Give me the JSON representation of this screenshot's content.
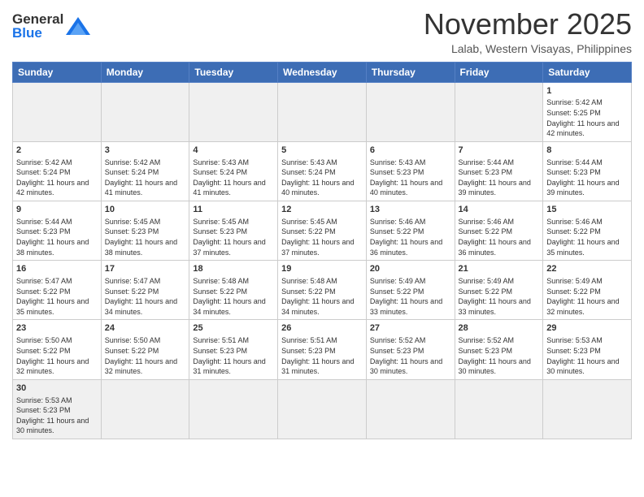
{
  "header": {
    "logo_text_general": "General",
    "logo_text_blue": "Blue",
    "month_title": "November 2025",
    "location": "Lalab, Western Visayas, Philippines"
  },
  "days_of_week": [
    "Sunday",
    "Monday",
    "Tuesday",
    "Wednesday",
    "Thursday",
    "Friday",
    "Saturday"
  ],
  "weeks": [
    [
      {
        "day": "",
        "empty": true
      },
      {
        "day": "",
        "empty": true
      },
      {
        "day": "",
        "empty": true
      },
      {
        "day": "",
        "empty": true
      },
      {
        "day": "",
        "empty": true
      },
      {
        "day": "",
        "empty": true
      },
      {
        "day": "1",
        "sunrise": "5:42 AM",
        "sunset": "5:25 PM",
        "daylight": "11 hours and 42 minutes."
      }
    ],
    [
      {
        "day": "2",
        "sunrise": "5:42 AM",
        "sunset": "5:24 PM",
        "daylight": "11 hours and 42 minutes."
      },
      {
        "day": "3",
        "sunrise": "5:42 AM",
        "sunset": "5:24 PM",
        "daylight": "11 hours and 41 minutes."
      },
      {
        "day": "4",
        "sunrise": "5:43 AM",
        "sunset": "5:24 PM",
        "daylight": "11 hours and 41 minutes."
      },
      {
        "day": "5",
        "sunrise": "5:43 AM",
        "sunset": "5:24 PM",
        "daylight": "11 hours and 40 minutes."
      },
      {
        "day": "6",
        "sunrise": "5:43 AM",
        "sunset": "5:23 PM",
        "daylight": "11 hours and 40 minutes."
      },
      {
        "day": "7",
        "sunrise": "5:44 AM",
        "sunset": "5:23 PM",
        "daylight": "11 hours and 39 minutes."
      },
      {
        "day": "8",
        "sunrise": "5:44 AM",
        "sunset": "5:23 PM",
        "daylight": "11 hours and 39 minutes."
      }
    ],
    [
      {
        "day": "9",
        "sunrise": "5:44 AM",
        "sunset": "5:23 PM",
        "daylight": "11 hours and 38 minutes."
      },
      {
        "day": "10",
        "sunrise": "5:45 AM",
        "sunset": "5:23 PM",
        "daylight": "11 hours and 38 minutes."
      },
      {
        "day": "11",
        "sunrise": "5:45 AM",
        "sunset": "5:23 PM",
        "daylight": "11 hours and 37 minutes."
      },
      {
        "day": "12",
        "sunrise": "5:45 AM",
        "sunset": "5:22 PM",
        "daylight": "11 hours and 37 minutes."
      },
      {
        "day": "13",
        "sunrise": "5:46 AM",
        "sunset": "5:22 PM",
        "daylight": "11 hours and 36 minutes."
      },
      {
        "day": "14",
        "sunrise": "5:46 AM",
        "sunset": "5:22 PM",
        "daylight": "11 hours and 36 minutes."
      },
      {
        "day": "15",
        "sunrise": "5:46 AM",
        "sunset": "5:22 PM",
        "daylight": "11 hours and 35 minutes."
      }
    ],
    [
      {
        "day": "16",
        "sunrise": "5:47 AM",
        "sunset": "5:22 PM",
        "daylight": "11 hours and 35 minutes."
      },
      {
        "day": "17",
        "sunrise": "5:47 AM",
        "sunset": "5:22 PM",
        "daylight": "11 hours and 34 minutes."
      },
      {
        "day": "18",
        "sunrise": "5:48 AM",
        "sunset": "5:22 PM",
        "daylight": "11 hours and 34 minutes."
      },
      {
        "day": "19",
        "sunrise": "5:48 AM",
        "sunset": "5:22 PM",
        "daylight": "11 hours and 34 minutes."
      },
      {
        "day": "20",
        "sunrise": "5:49 AM",
        "sunset": "5:22 PM",
        "daylight": "11 hours and 33 minutes."
      },
      {
        "day": "21",
        "sunrise": "5:49 AM",
        "sunset": "5:22 PM",
        "daylight": "11 hours and 33 minutes."
      },
      {
        "day": "22",
        "sunrise": "5:49 AM",
        "sunset": "5:22 PM",
        "daylight": "11 hours and 32 minutes."
      }
    ],
    [
      {
        "day": "23",
        "sunrise": "5:50 AM",
        "sunset": "5:22 PM",
        "daylight": "11 hours and 32 minutes."
      },
      {
        "day": "24",
        "sunrise": "5:50 AM",
        "sunset": "5:22 PM",
        "daylight": "11 hours and 32 minutes."
      },
      {
        "day": "25",
        "sunrise": "5:51 AM",
        "sunset": "5:23 PM",
        "daylight": "11 hours and 31 minutes."
      },
      {
        "day": "26",
        "sunrise": "5:51 AM",
        "sunset": "5:23 PM",
        "daylight": "11 hours and 31 minutes."
      },
      {
        "day": "27",
        "sunrise": "5:52 AM",
        "sunset": "5:23 PM",
        "daylight": "11 hours and 30 minutes."
      },
      {
        "day": "28",
        "sunrise": "5:52 AM",
        "sunset": "5:23 PM",
        "daylight": "11 hours and 30 minutes."
      },
      {
        "day": "29",
        "sunrise": "5:53 AM",
        "sunset": "5:23 PM",
        "daylight": "11 hours and 30 minutes."
      }
    ],
    [
      {
        "day": "30",
        "sunrise": "5:53 AM",
        "sunset": "5:23 PM",
        "daylight": "11 hours and 30 minutes.",
        "last_row": true
      },
      {
        "day": "",
        "empty": true,
        "last_row": true
      },
      {
        "day": "",
        "empty": true,
        "last_row": true
      },
      {
        "day": "",
        "empty": true,
        "last_row": true
      },
      {
        "day": "",
        "empty": true,
        "last_row": true
      },
      {
        "day": "",
        "empty": true,
        "last_row": true
      },
      {
        "day": "",
        "empty": true,
        "last_row": true
      }
    ]
  ],
  "labels": {
    "sunrise": "Sunrise:",
    "sunset": "Sunset:",
    "daylight": "Daylight:"
  }
}
